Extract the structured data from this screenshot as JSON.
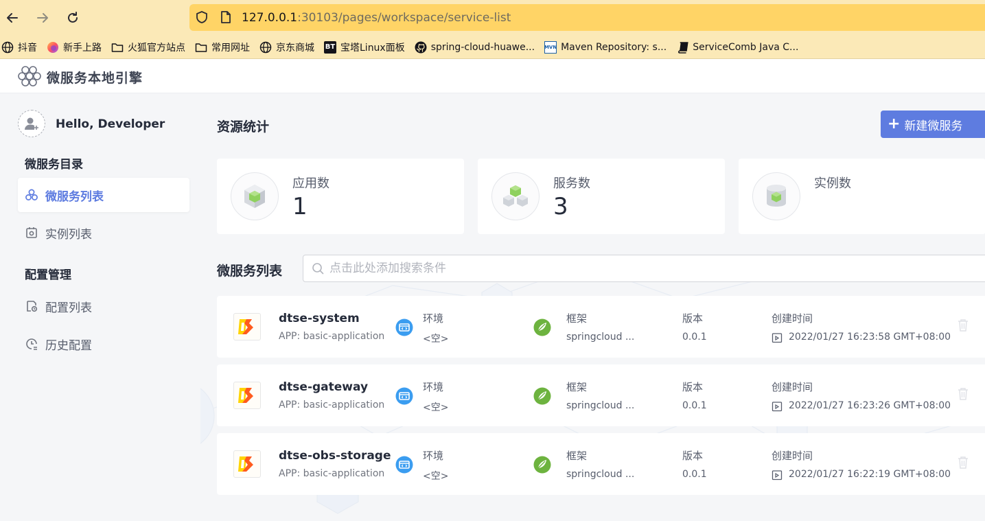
{
  "browser": {
    "url_host": "127.0.0.1",
    "url_path": ":30103/pages/workspace/service-list",
    "bookmarks": [
      {
        "label": "抖音",
        "icon": "globe-icon"
      },
      {
        "label": "新手上路",
        "icon": "firefox-icon"
      },
      {
        "label": "火狐官方站点",
        "icon": "folder-icon"
      },
      {
        "label": "常用网址",
        "icon": "folder-icon"
      },
      {
        "label": "京东商城",
        "icon": "globe-icon"
      },
      {
        "label": "宝塔Linux面板",
        "icon": "bt-icon"
      },
      {
        "label": "spring-cloud-huawe...",
        "icon": "github-icon"
      },
      {
        "label": "Maven Repository: s...",
        "icon": "mvn-icon"
      },
      {
        "label": "ServiceComb Java C...",
        "icon": "book-icon"
      }
    ],
    "bt_icon_text": "BT",
    "mvn_icon_text": "MVN"
  },
  "app": {
    "title": "微服务本地引擎"
  },
  "sidebar": {
    "greeting": "Hello, Developer",
    "groups": [
      {
        "title": "微服务目录"
      },
      {
        "title": "配置管理"
      }
    ],
    "items": [
      {
        "label": "微服务列表",
        "active": true
      },
      {
        "label": "实例列表",
        "active": false
      },
      {
        "label": "配置列表",
        "active": false
      },
      {
        "label": "历史配置",
        "active": false
      }
    ]
  },
  "main": {
    "resource_title": "资源统计",
    "new_button_label": "新建微服务",
    "stats": [
      {
        "label": "应用数",
        "value": "1"
      },
      {
        "label": "服务数",
        "value": "3"
      },
      {
        "label": "实例数",
        "value": ""
      }
    ],
    "list_title": "微服务列表",
    "search_placeholder": "点击此处添加搜索条件",
    "services": [
      {
        "name": "dtse-system",
        "app": "APP: basic-application",
        "env_label": "环境",
        "env": "<空>",
        "framework_label": "框架",
        "framework": "springcloud ...",
        "version_label": "版本",
        "version": "0.0.1",
        "created_label": "创建时间",
        "created": "2022/01/27 16:23:58 GMT+08:00"
      },
      {
        "name": "dtse-gateway",
        "app": "APP: basic-application",
        "env_label": "环境",
        "env": "<空>",
        "framework_label": "框架",
        "framework": "springcloud ...",
        "version_label": "版本",
        "version": "0.0.1",
        "created_label": "创建时间",
        "created": "2022/01/27 16:23:26 GMT+08:00"
      },
      {
        "name": "dtse-obs-storage",
        "app": "APP: basic-application",
        "env_label": "环境",
        "env": "<空>",
        "framework_label": "框架",
        "framework": "springcloud ...",
        "version_label": "版本",
        "version": "0.0.1",
        "created_label": "创建时间",
        "created": "2022/01/27 16:22:19 GMT+08:00"
      }
    ]
  },
  "colors": {
    "accent": "#5e7ce0",
    "browser_bar": "#fbe9b7",
    "url_bar": "#ffd466"
  }
}
